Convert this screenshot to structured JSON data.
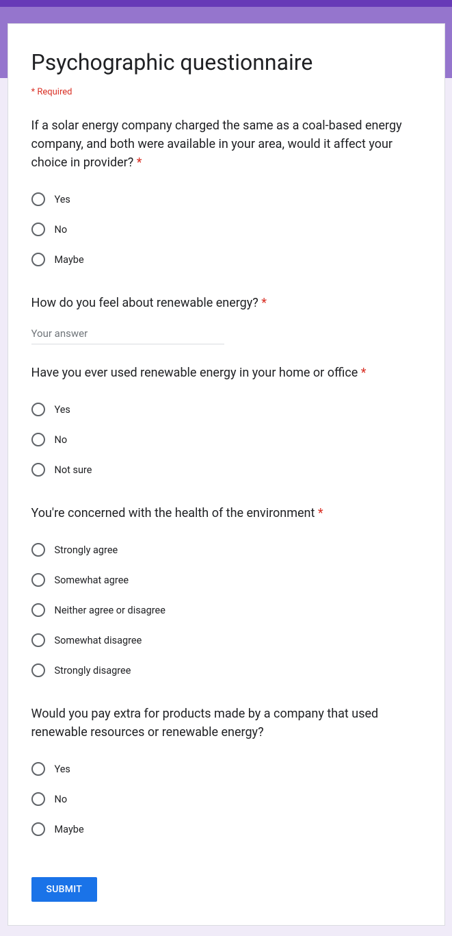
{
  "form": {
    "title": "Psychographic questionnaire",
    "required_note": "* Required",
    "submit_label": "Submit"
  },
  "q1": {
    "text": "If a solar energy company charged the same as a coal-based energy company, and both were available in your area, would it affect your choice in provider? ",
    "required": "*",
    "opt1": "Yes",
    "opt2": "No",
    "opt3": "Maybe"
  },
  "q2": {
    "text": "How do you feel about renewable energy? ",
    "required": "*",
    "placeholder": "Your answer"
  },
  "q3": {
    "text": "Have you ever used renewable energy in your home or office ",
    "required": "*",
    "opt1": "Yes",
    "opt2": "No",
    "opt3": "Not sure"
  },
  "q4": {
    "text": "You're concerned with the health of the environment ",
    "required": "*",
    "opt1": "Strongly agree",
    "opt2": "Somewhat agree",
    "opt3": "Neither agree or disagree",
    "opt4": "Somewhat disagree",
    "opt5": "Strongly disagree"
  },
  "q5": {
    "text": "Would you pay extra for products made by a company that used renewable resources or renewable energy?",
    "opt1": "Yes",
    "opt2": "No",
    "opt3": "Maybe"
  }
}
